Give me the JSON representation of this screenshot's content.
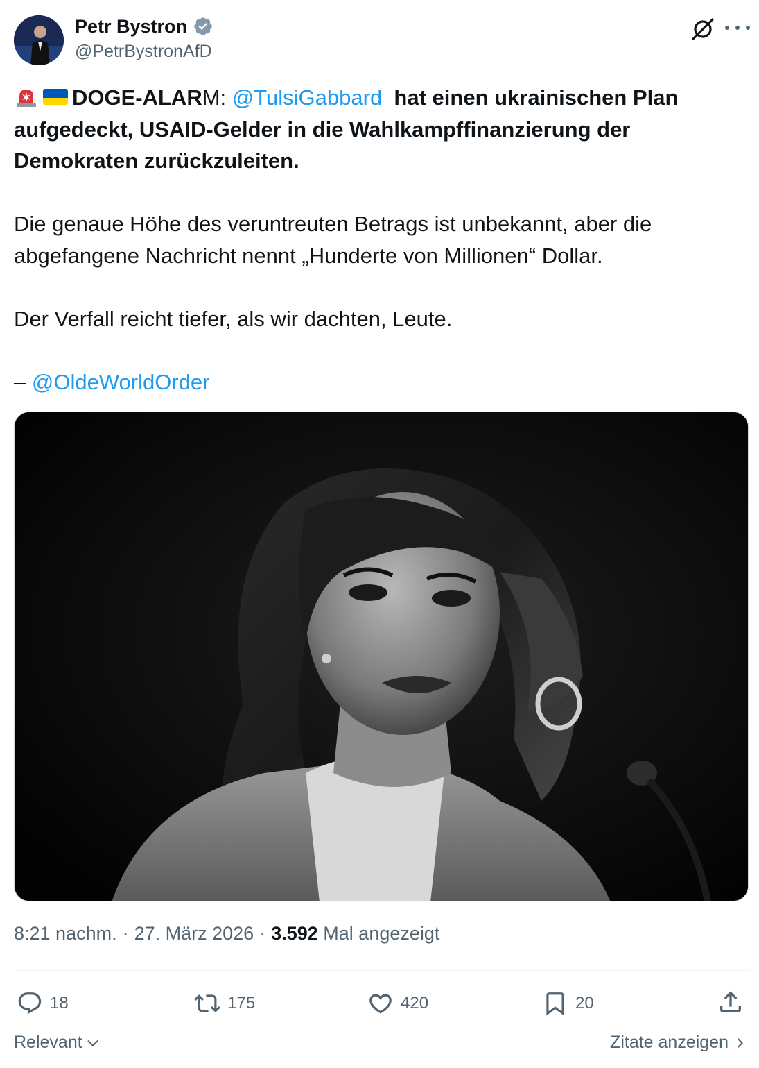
{
  "author": {
    "name": "Petr Bystron",
    "handle": "@PetrBystronAfD",
    "verified": true
  },
  "tweet": {
    "emojis": [
      "police-light-emoji",
      "ukraine-flag-emoji"
    ],
    "line1_bold": "DOGE-ALAR",
    "line1_normal": "M: ",
    "mention1": "@TulsiGabbard",
    "line1_rest": "  hat einen ukrainischen Plan",
    "line2": "aufgedeckt, USAID-Gelder in die Wahlkampffinanzierung der",
    "line3": "Demokraten zurückzuleiten.",
    "para2_line1": "Die genaue Höhe des veruntreuten Betrags ist unbekannt, aber die",
    "para2_line2": "abgefangene Nachricht nennt „Hunderte von Millionen“ Dollar.",
    "para3": "Der Verfall reicht tiefer, als wir dachten, Leute.",
    "attribution_prefix": "– ",
    "attribution_mention": "@OldeWorldOrder"
  },
  "meta": {
    "time": "8:21 nachm.",
    "sep1": "·",
    "date": "27. März 2026",
    "sep2": "·",
    "views_count": "3.592",
    "views_label": "Mal angezeigt"
  },
  "actions": {
    "replies": "18",
    "reposts": "175",
    "likes": "420",
    "bookmarks": "20"
  },
  "footer": {
    "sort_label": "Relevant",
    "quotes_label": "Zitate anzeigen"
  },
  "colors": {
    "link": "#1d9bf0",
    "secondary": "#536471",
    "text": "#0f1419",
    "verified": "#829aab"
  }
}
